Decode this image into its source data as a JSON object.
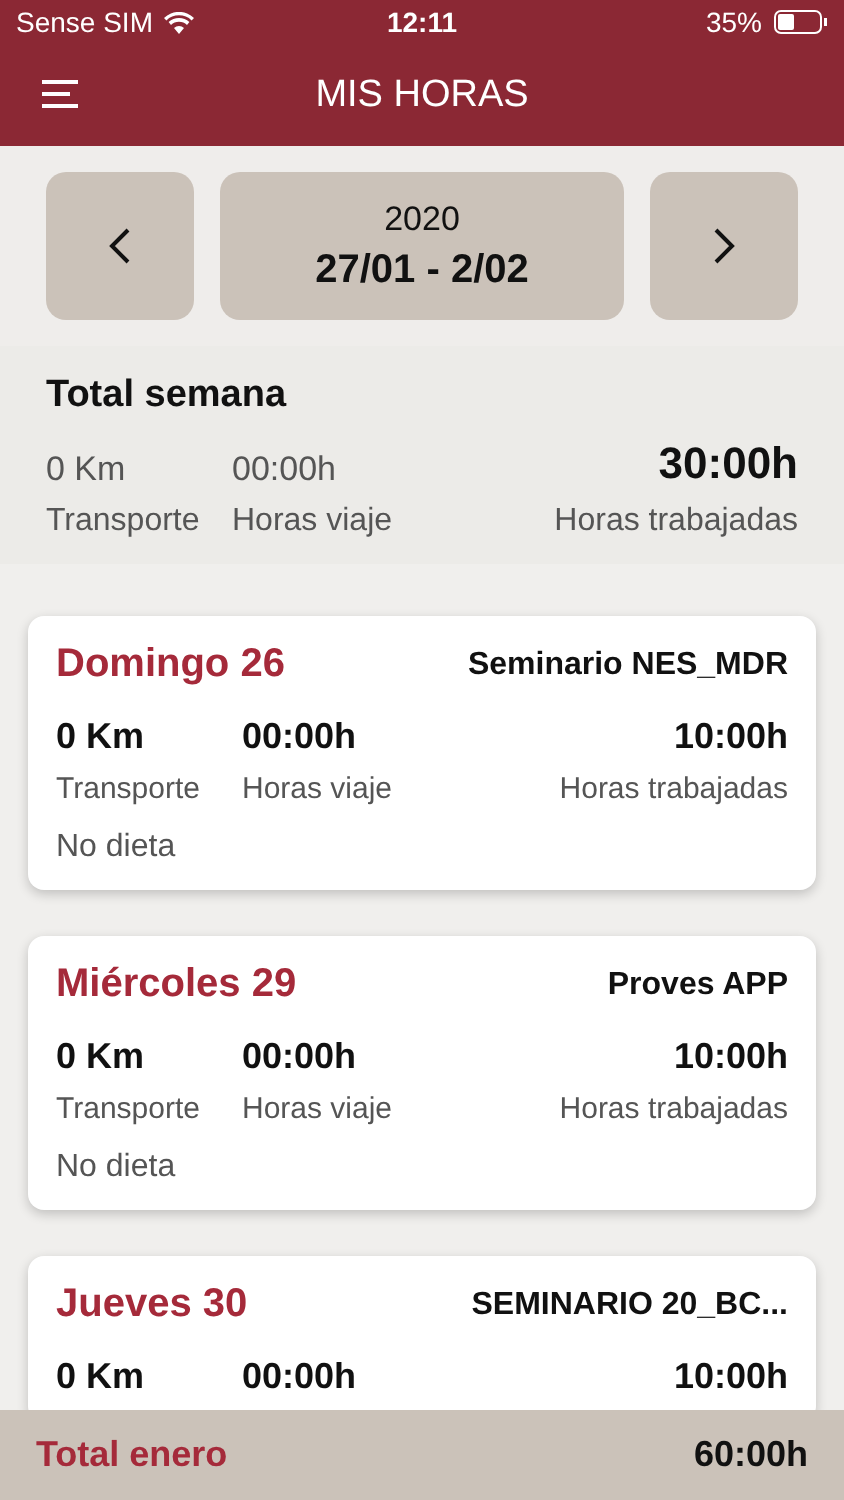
{
  "status_bar": {
    "carrier": "Sense SIM",
    "time": "12:11",
    "battery": "35%"
  },
  "header": {
    "title": "MIS HORAS"
  },
  "week_nav": {
    "year": "2020",
    "range": "27/01 - 2/02"
  },
  "week_total": {
    "title": "Total semana",
    "transport": "0 Km",
    "transport_label": "Transporte",
    "travel": "00:00h",
    "travel_label": "Horas viaje",
    "worked": "30:00h",
    "worked_label": "Horas trabajadas"
  },
  "days": [
    {
      "day": "Domingo 26",
      "project": "Seminario NES_MDR",
      "transport": "0 Km",
      "transport_label": "Transporte",
      "travel": "00:00h",
      "travel_label": "Horas viaje",
      "worked": "10:00h",
      "worked_label": "Horas trabajadas",
      "diet": "No dieta"
    },
    {
      "day": "Miércoles 29",
      "project": "Proves APP",
      "transport": "0 Km",
      "transport_label": "Transporte",
      "travel": "00:00h",
      "travel_label": "Horas viaje",
      "worked": "10:00h",
      "worked_label": "Horas trabajadas",
      "diet": "No dieta"
    },
    {
      "day": "Jueves 30",
      "project": "SEMINARIO 20_BC...",
      "transport": "0 Km",
      "travel": "00:00h",
      "worked": "10:00h"
    }
  ],
  "month_total": {
    "label": "Total enero",
    "value": "60:00h"
  }
}
